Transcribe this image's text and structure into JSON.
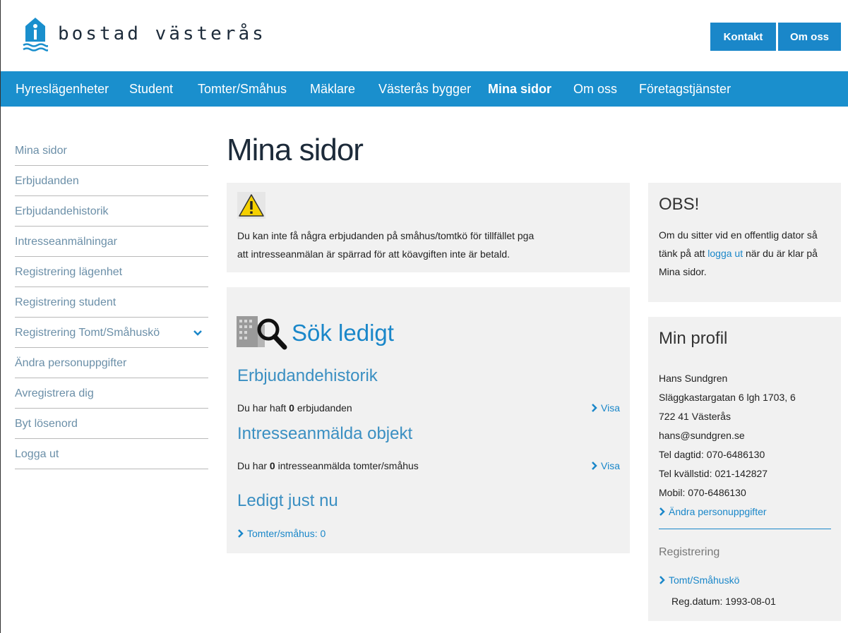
{
  "brand": {
    "name": "bostad västerås"
  },
  "top_buttons": {
    "kontakt": "Kontakt",
    "om_oss": "Om oss"
  },
  "nav": {
    "items": [
      "Hyreslägenheter",
      "Student",
      "Tomter/Småhus",
      "Mäklare",
      "Västerås bygger",
      "Mina sidor",
      "Om oss",
      "Företagstjänster"
    ],
    "active": "Mina sidor"
  },
  "sidebar": {
    "items": [
      "Mina sidor",
      "Erbjudanden",
      "Erbjudandehistorik",
      "Intresseanmälningar",
      "Registrering lägenhet",
      "Registrering student",
      "Registrering Tomt/Småhuskö",
      "Ändra personuppgifter",
      "Avregistrera dig",
      "Byt lösenord",
      "Logga ut"
    ]
  },
  "main": {
    "title": "Mina sidor",
    "warning": {
      "line1": "Du kan inte få några erbjudanden på småhus/tomtkö för tillfället pga",
      "line2": "att intresseanmälan är spärrad för att köavgiften inte är betald."
    },
    "search": {
      "title": "Sök ledigt",
      "history_heading": "Erbjudandehistorik",
      "history_prefix": "Du har haft ",
      "history_count": "0",
      "history_suffix": " erbjudanden",
      "visa": "Visa",
      "interest_heading": "Intresseanmälda objekt",
      "interest_prefix": "Du har ",
      "interest_count": "0",
      "interest_suffix": " intresseanmälda tomter/småhus",
      "available_heading": "Ledigt just nu",
      "available_link": "Tomter/småhus: 0"
    }
  },
  "obs": {
    "title": "OBS!",
    "text_before": "Om du sitter vid en offentlig dator så tänk på att ",
    "link": "logga ut",
    "text_after": " när du är klar på Mina sidor."
  },
  "profile": {
    "title": "Min profil",
    "name": "Hans Sundgren",
    "address": "Släggkastargatan 6 lgh 1703, 6",
    "city": "722 41 Västerås",
    "email": "hans@sundgren.se",
    "tel_day": "Tel dagtid: 070-6486130",
    "tel_evening": "Tel kvällstid: 021-142827",
    "mobile": "Mobil: 070-6486130",
    "edit_link": "Ändra personuppgifter",
    "registration_label": "Registrering",
    "queue_link": "Tomt/Småhuskö",
    "reg_date": "Reg.datum: 1993-08-01"
  },
  "colors": {
    "brand_blue": "#1a8fcd",
    "panel_gray": "#f1f1f1"
  }
}
